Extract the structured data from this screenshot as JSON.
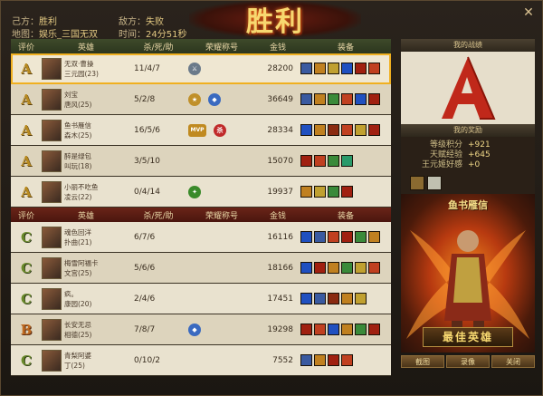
{
  "header": {
    "side_label": "己方：",
    "side_value": "胜利",
    "enemy_label": "敌方：",
    "enemy_value": "失败",
    "map_label": "地图：",
    "map_value": "娱乐_三国无双",
    "time_label": "时间：",
    "time_value": "24分51秒",
    "banner": "胜利"
  },
  "columns": [
    "评价",
    "英雄",
    "杀/死/助",
    "荣耀称号",
    "金钱",
    "装备"
  ],
  "team_win": [
    {
      "rank": "A",
      "name": "无双·曹操",
      "sub": "三元园(23)",
      "kda": "11/4/7",
      "titles": [
        "sword"
      ],
      "gold": "28200",
      "selected": true,
      "equip": [
        "#3a5aa0",
        "#c08020",
        "#c0a030",
        "#2050c0",
        "#a02010",
        "#c04020"
      ]
    },
    {
      "rank": "A",
      "name": "刘宝",
      "sub": "唐风(25)",
      "kda": "5/2/8",
      "titles": [
        "gold",
        "blue"
      ],
      "gold": "36649",
      "selected": false,
      "equip": [
        "#3a5aa0",
        "#c08020",
        "#3a8a3a",
        "#c04020",
        "#2050c0",
        "#a02010"
      ]
    },
    {
      "rank": "A",
      "name": "鱼书雁信",
      "sub": "森木(25)",
      "kda": "16/5/6",
      "titles": [
        "mvp",
        "red"
      ],
      "gold": "28334",
      "selected": false,
      "equip": [
        "#2050c0",
        "#c08020",
        "#8a2a10",
        "#c04020",
        "#c0a030",
        "#a02010"
      ]
    },
    {
      "rank": "A",
      "name": "醉是绿包",
      "sub": "叫玩(18)",
      "kda": "3/5/10",
      "titles": [],
      "gold": "15070",
      "selected": false,
      "equip": [
        "#a02010",
        "#c04020",
        "#3a8a3a",
        "#2a9a6a"
      ]
    },
    {
      "rank": "A",
      "name": "小丽不吃鱼",
      "sub": "凌云(22)",
      "kda": "0/4/14",
      "titles": [
        "green"
      ],
      "gold": "19937",
      "selected": false,
      "equip": [
        "#c08020",
        "#c0a030",
        "#3a8a3a",
        "#a02010"
      ]
    }
  ],
  "team_lose": [
    {
      "rank": "C",
      "name": "魂色回洋",
      "sub": "扑曲(21)",
      "kda": "6/7/6",
      "titles": [],
      "gold": "16116",
      "selected": false,
      "equip": [
        "#2050c0",
        "#3a5aa0",
        "#c04020",
        "#a02010",
        "#3a8a3a",
        "#c08020"
      ]
    },
    {
      "rank": "C",
      "name": "梅雪阿福卡",
      "sub": "文宫(25)",
      "kda": "5/6/6",
      "titles": [],
      "gold": "18166",
      "selected": false,
      "equip": [
        "#2050c0",
        "#a02010",
        "#c08020",
        "#3a8a3a",
        "#c0a030",
        "#c04020"
      ]
    },
    {
      "rank": "C",
      "name": "疯。",
      "sub": "康园(20)",
      "kda": "2/4/6",
      "titles": [],
      "gold": "17451",
      "selected": false,
      "equip": [
        "#2050c0",
        "#3a5aa0",
        "#8a2a10",
        "#c08020",
        "#c0a030"
      ]
    },
    {
      "rank": "B",
      "name": "长安无忌",
      "sub": "相德(25)",
      "kda": "7/8/7",
      "titles": [
        "blue"
      ],
      "gold": "19298",
      "selected": false,
      "equip": [
        "#a02010",
        "#c04020",
        "#2050c0",
        "#c08020",
        "#3a8a3a",
        "#a02010"
      ]
    },
    {
      "rank": "C",
      "name": "青梨阿婆",
      "sub": "丁(25)",
      "kda": "0/10/2",
      "titles": [],
      "gold": "7552",
      "selected": false,
      "equip": [
        "#3a5aa0",
        "#c08020",
        "#a02010",
        "#c04020"
      ]
    }
  ],
  "right_panel": {
    "record_title": "我的战绩",
    "reward_title": "我的奖励",
    "stats": [
      {
        "key": "等级积分",
        "value": "+921"
      },
      {
        "key": "天赋经验",
        "value": "+645"
      },
      {
        "key": "王元姬好感",
        "value": "+0"
      }
    ],
    "hero_name": "鱼书雁信",
    "best_label": "最佳英雄",
    "buttons": [
      "截图",
      "录像",
      "关闭"
    ]
  }
}
